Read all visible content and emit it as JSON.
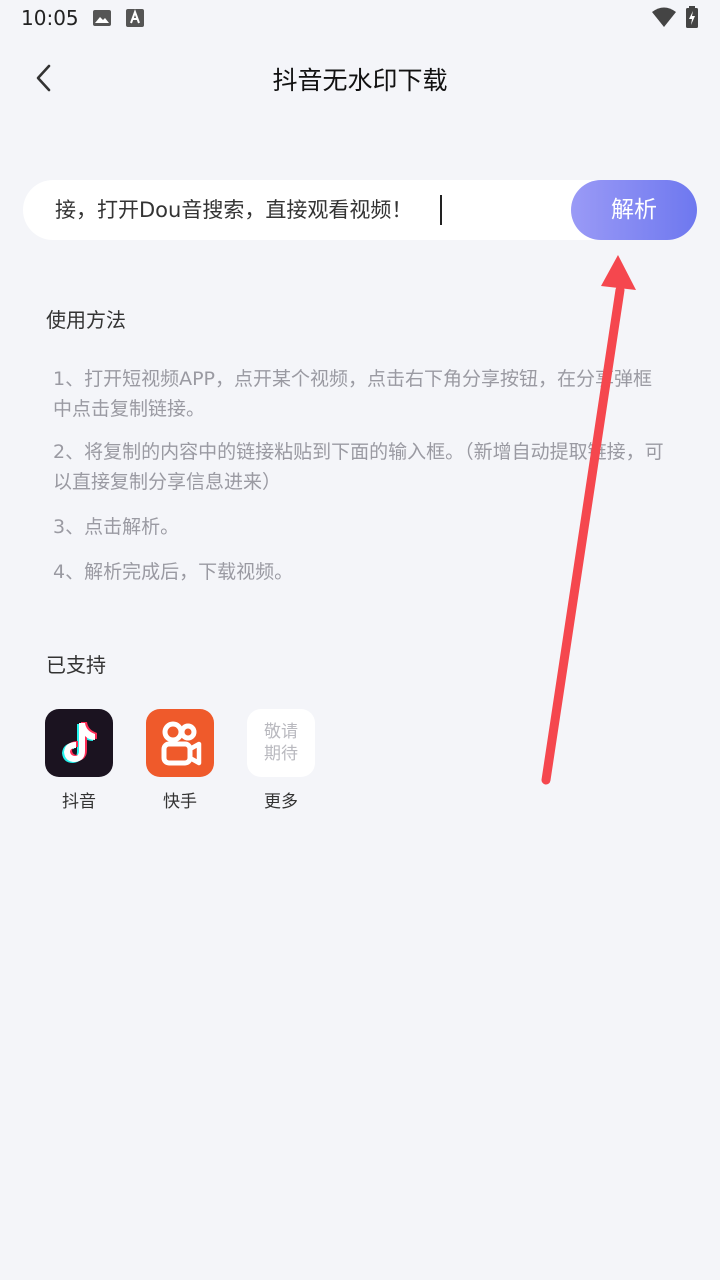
{
  "status_bar": {
    "time": "10:05",
    "icons": [
      "image-icon",
      "a-badge-icon",
      "wifi-icon",
      "battery-charging-icon"
    ]
  },
  "header": {
    "back_icon": "chevron-left-icon",
    "title": "抖音无水印下载"
  },
  "search": {
    "value": "接，打开Dou音搜索，直接观看视频！",
    "button_label": "解析"
  },
  "usage": {
    "title": "使用方法",
    "steps": [
      "1、打开短视频APP，点开某个视频，点击右下角分享按钮，在分享弹框中点击复制链接。",
      "2、将复制的内容中的链接粘贴到下面的输入框。（新增自动提取链接，可以直接复制分享信息进来）",
      "3、点击解析。",
      "4、解析完成后，下载视频。"
    ]
  },
  "supported": {
    "title": "已支持",
    "apps": [
      {
        "label": "抖音",
        "icon": "tiktok-icon",
        "color": "#1b1320"
      },
      {
        "label": "快手",
        "icon": "kuaishou-icon",
        "color": "#ef5a2b"
      },
      {
        "label": "更多",
        "icon": "more-placeholder",
        "placeholder": "敬请期待"
      }
    ]
  },
  "colors": {
    "accent_start": "#9a9af6",
    "accent_end": "#6e78ef",
    "annotation_arrow": "#f5474e",
    "background": "#f4f5f9"
  }
}
